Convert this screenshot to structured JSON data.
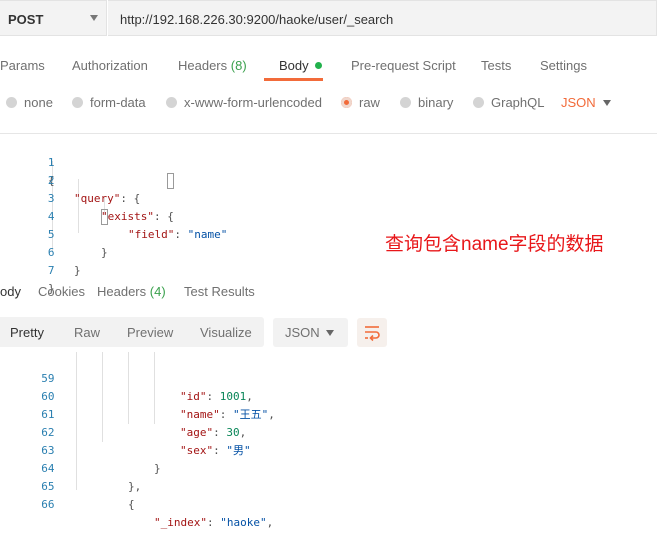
{
  "request": {
    "method": "POST",
    "url": "http://192.168.226.30:9200/haoke/user/_search"
  },
  "tabs": [
    {
      "label": "Params"
    },
    {
      "label": "Authorization"
    },
    {
      "label": "Headers",
      "count": "(8)"
    },
    {
      "label": "Body"
    },
    {
      "label": "Pre-request Script"
    },
    {
      "label": "Tests"
    },
    {
      "label": "Settings"
    }
  ],
  "body_types": [
    "none",
    "form-data",
    "x-www-form-urlencoded",
    "raw",
    "binary",
    "GraphQL"
  ],
  "body_format": "JSON",
  "request_body": [
    {
      "no": "1",
      "text": "{"
    },
    {
      "no": "2",
      "key": "\"query\"",
      "rest": ": {"
    },
    {
      "no": "3",
      "key": "\"exists\"",
      "rest": ": {"
    },
    {
      "no": "4",
      "key": "\"field\"",
      "sep": ": ",
      "val": "\"name\""
    },
    {
      "no": "5",
      "text": "}"
    },
    {
      "no": "6",
      "text": "}"
    },
    {
      "no": "7",
      "text": "}"
    }
  ],
  "annotation": "查询包含name字段的数据",
  "response_tabs": [
    {
      "label": "ody"
    },
    {
      "label": "Cookies"
    },
    {
      "label": "Headers",
      "count": "(4)"
    },
    {
      "label": "Test Results"
    }
  ],
  "view_modes": [
    "Pretty",
    "Raw",
    "Preview",
    "Visualize"
  ],
  "response_format": "JSON",
  "response_body": [
    {
      "no": "59",
      "key": "\"id\"",
      "sep": ": ",
      "num": "1001",
      "tail": ","
    },
    {
      "no": "60",
      "key": "\"name\"",
      "sep": ": ",
      "val": "\"王五\"",
      "tail": ","
    },
    {
      "no": "61",
      "key": "\"age\"",
      "sep": ": ",
      "num": "30",
      "tail": ","
    },
    {
      "no": "62",
      "key": "\"sex\"",
      "sep": ": ",
      "val": "\"男\""
    },
    {
      "no": "63",
      "text": "}"
    },
    {
      "no": "64",
      "text": "},"
    },
    {
      "no": "65",
      "text": "{"
    },
    {
      "no": "66",
      "key": "\"_index\"",
      "sep": ": ",
      "val": "\"haoke\"",
      "tail": ","
    }
  ],
  "colors": {
    "accent": "#f26b3a",
    "status_dot": "#22b14c",
    "annotation": "#e8171a"
  }
}
